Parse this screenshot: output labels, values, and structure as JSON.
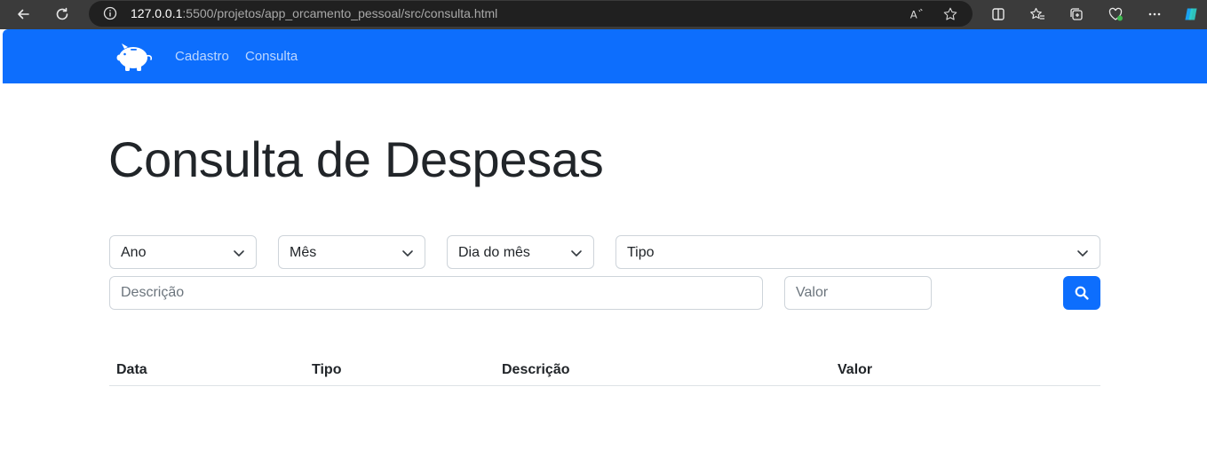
{
  "browser": {
    "url_host": "127.0.0.1",
    "url_path": ":5500/projetos/app_orcamento_pessoal/src/consulta.html"
  },
  "navbar": {
    "brand_icon": "piggy-bank-icon",
    "links": [
      "Cadastro",
      "Consulta"
    ],
    "background": "#0d6efd"
  },
  "page": {
    "title": "Consulta de Despesas"
  },
  "filters": {
    "ano": "Ano",
    "mes": "Mês",
    "dia": "Dia do mês",
    "tipo": "Tipo",
    "descricao_placeholder": "Descrição",
    "valor_placeholder": "Valor",
    "search_icon": "search-icon"
  },
  "table": {
    "headers": [
      "Data",
      "Tipo",
      "Descrição",
      "Valor"
    ]
  }
}
